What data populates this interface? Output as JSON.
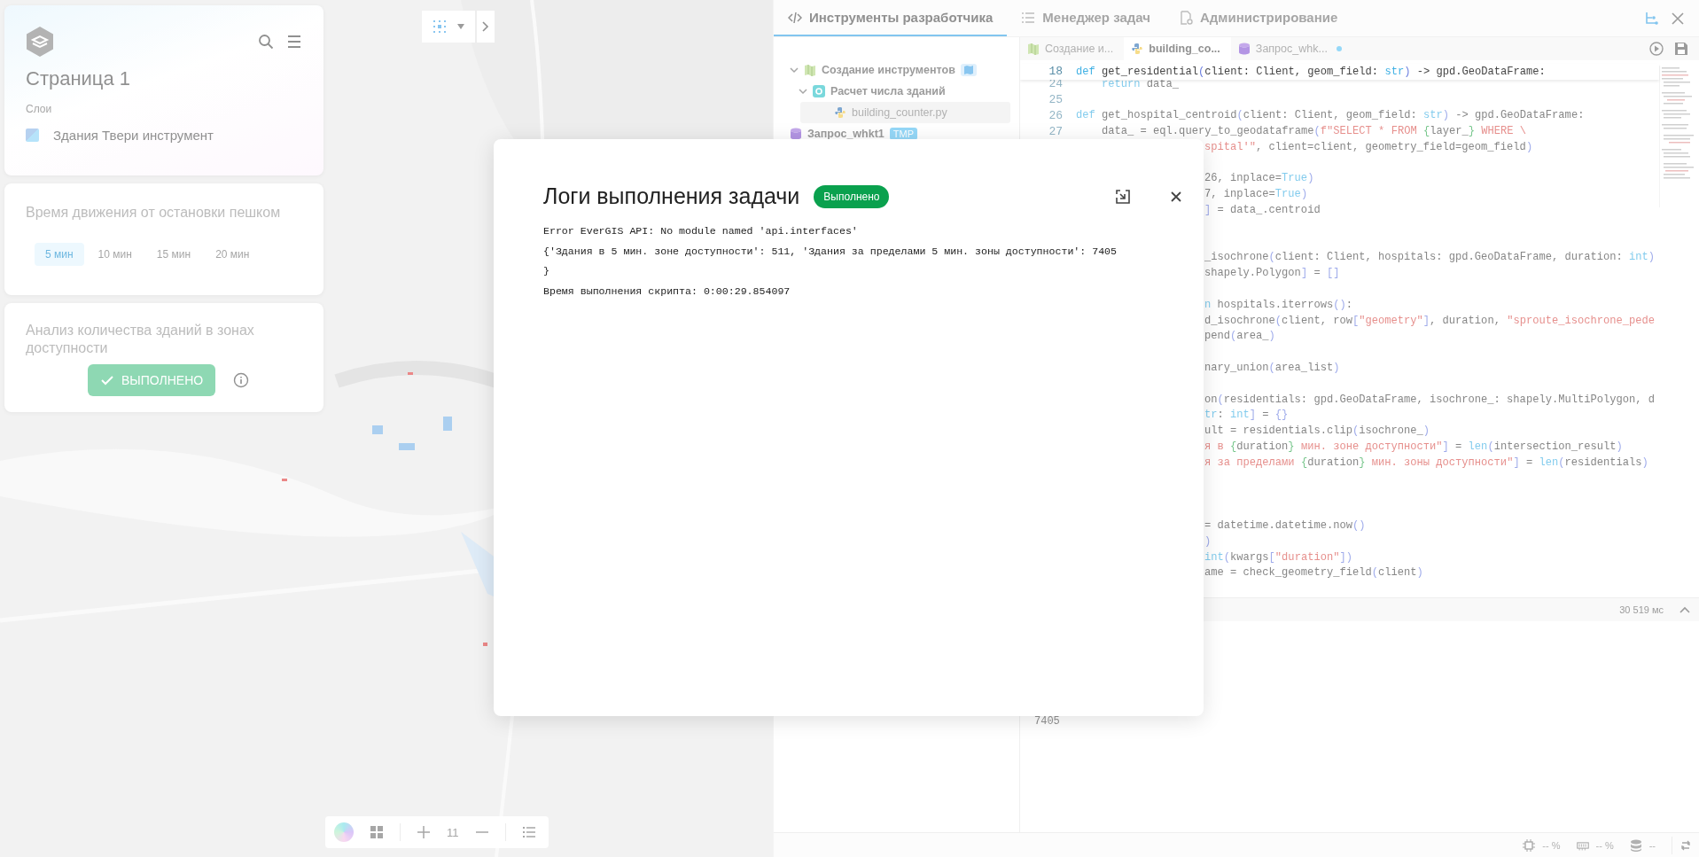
{
  "page_card": {
    "title": "Страница 1",
    "layers_label": "Слои",
    "layers": [
      {
        "name": "Здания Твери инструмент"
      }
    ]
  },
  "walk_card": {
    "title": "Время движения от остановки пешком",
    "options": [
      {
        "label": "5 мин",
        "selected": true
      },
      {
        "label": "10 мин",
        "selected": false
      },
      {
        "label": "15 мин",
        "selected": false
      },
      {
        "label": "20 мин",
        "selected": false
      }
    ]
  },
  "analysis_card": {
    "title": "Анализ количества зданий в зонах доступности",
    "button": "ВЫПОЛНЕНО"
  },
  "map_toolbar": {
    "zoom": "11"
  },
  "devtools": {
    "tabs": [
      {
        "label": "Инструменты разработчика",
        "kind": "code",
        "selected": true
      },
      {
        "label": "Менеджер задач",
        "kind": "list",
        "selected": false
      },
      {
        "label": "Администрирование",
        "kind": "admin",
        "selected": false
      }
    ],
    "tree": [
      {
        "label": "Создание инструментов",
        "kind": "project",
        "expanded": true,
        "selected": false,
        "children": [
          {
            "label": "Расчет числа зданий",
            "kind": "tool",
            "expanded": true,
            "selected": false,
            "children": [
              {
                "label": "building_counter.py",
                "kind": "python",
                "selected": true
              }
            ]
          }
        ]
      },
      {
        "label": "Запрос_whkt1",
        "kind": "query",
        "badge": "TMP",
        "selected": false
      }
    ]
  },
  "editor": {
    "tabs": [
      {
        "label": "Создание и...",
        "kind": "project",
        "selected": false,
        "modified": false
      },
      {
        "label": "building_co...",
        "kind": "python",
        "selected": true,
        "modified": false
      },
      {
        "label": "Запрос_whk...",
        "kind": "query",
        "selected": false,
        "modified": true
      }
    ],
    "code": [
      {
        "kind": "code",
        "number": "18",
        "segments": [
          {
            "kind": "keyword",
            "text": "def"
          },
          {
            "text": " get_residential"
          },
          {
            "kind": "paren",
            "text": "("
          },
          {
            "text": "client: Client, geom_field: "
          },
          {
            "kind": "keyword",
            "text": "str"
          },
          {
            "kind": "paren",
            "text": ")"
          },
          {
            "text": " -> gpd.GeoDataFrame:"
          }
        ]
      },
      {
        "kind": "code",
        "number": "24",
        "segments": [
          {
            "kind": "keyword",
            "text": "    return"
          },
          {
            "text": " data_"
          }
        ]
      },
      {
        "kind": "code",
        "number": "25"
      },
      {
        "kind": "code",
        "number": "26",
        "segments": [
          {
            "kind": "keyword",
            "text": "def"
          },
          {
            "text": " get_hospital_centroid"
          },
          {
            "kind": "paren",
            "text": "("
          },
          {
            "text": "client: Client, geom_field: "
          },
          {
            "kind": "keyword",
            "text": "str"
          },
          {
            "kind": "paren",
            "text": ")"
          },
          {
            "text": " -> gpd.GeoDataFrame:"
          }
        ]
      },
      {
        "kind": "code",
        "number": "27",
        "segments": [
          {
            "text": "    data_ = eql.query_to_geodataframe"
          },
          {
            "kind": "paren",
            "text": "("
          },
          {
            "kind": "string",
            "text": "f\"SELECT * FROM "
          },
          {
            "kind": "brace",
            "text": "{"
          },
          {
            "text": "layer_"
          },
          {
            "kind": "brace",
            "text": "}"
          },
          {
            "kind": "string",
            "text": " WHERE \\"
          }
        ]
      },
      {
        "kind": "code",
        "cut": true,
        "segments": [
          {
            "kind": "string",
            "text": "spital'\""
          },
          {
            "text": ", client=client, geometry_field=geom_field"
          },
          {
            "kind": "paren",
            "text": ")"
          }
        ]
      },
      {
        "kind": "blank"
      },
      {
        "kind": "code",
        "cut": true,
        "segments": [
          {
            "text": "26, inplace="
          },
          {
            "kind": "keyword",
            "text": "True"
          },
          {
            "kind": "paren",
            "text": ")"
          }
        ]
      },
      {
        "kind": "code",
        "cut": true,
        "segments": [
          {
            "text": "7, inplace="
          },
          {
            "kind": "keyword",
            "text": "True"
          },
          {
            "kind": "paren",
            "text": ")"
          }
        ]
      },
      {
        "kind": "code",
        "cut": true,
        "segments": [
          {
            "kind": "paren",
            "text": "]"
          },
          {
            "text": " = data_.centroid"
          }
        ]
      },
      {
        "kind": "blank"
      },
      {
        "kind": "blank"
      },
      {
        "kind": "code",
        "cut": true,
        "segments": [
          {
            "text": "_isochrone"
          },
          {
            "kind": "paren",
            "text": "("
          },
          {
            "text": "client: Client, hospitals: gpd.GeoDataFrame, duration: "
          },
          {
            "kind": "keyword",
            "text": "int"
          },
          {
            "kind": "paren",
            "text": ")"
          }
        ]
      },
      {
        "kind": "code",
        "cut": true,
        "segments": [
          {
            "text": "shapely.Polygon"
          },
          {
            "kind": "paren",
            "text": "]"
          },
          {
            "text": " = "
          },
          {
            "kind": "paren",
            "text": "[]"
          }
        ]
      },
      {
        "kind": "blank"
      },
      {
        "kind": "code",
        "cut": true,
        "segments": [
          {
            "kind": "keyword",
            "text": "n"
          },
          {
            "text": " hospitals.iterrows"
          },
          {
            "kind": "paren",
            "text": "()"
          },
          {
            "text": ":"
          }
        ]
      },
      {
        "kind": "code",
        "cut": true,
        "segments": [
          {
            "text": "d_isochrone"
          },
          {
            "kind": "paren",
            "text": "("
          },
          {
            "text": "client, row"
          },
          {
            "kind": "paren",
            "text": "["
          },
          {
            "kind": "string",
            "text": "\"geometry\""
          },
          {
            "kind": "paren",
            "text": "]"
          },
          {
            "text": ", duration, "
          },
          {
            "kind": "string",
            "text": "\"sproute_isochrone_pede"
          }
        ]
      },
      {
        "kind": "code",
        "cut": true,
        "segments": [
          {
            "text": "pend"
          },
          {
            "kind": "paren",
            "text": "("
          },
          {
            "text": "area_"
          },
          {
            "kind": "paren",
            "text": ")"
          }
        ]
      },
      {
        "kind": "blank"
      },
      {
        "kind": "code",
        "cut": true,
        "segments": [
          {
            "text": "nary_union"
          },
          {
            "kind": "paren",
            "text": "("
          },
          {
            "text": "area_list"
          },
          {
            "kind": "paren",
            "text": ")"
          }
        ]
      },
      {
        "kind": "blank"
      },
      {
        "kind": "code",
        "cut": true,
        "segments": [
          {
            "text": "on"
          },
          {
            "kind": "paren",
            "text": "("
          },
          {
            "text": "residentials: gpd.GeoDataFrame, isochrone_: shapely.MultiPolygon, d"
          }
        ]
      },
      {
        "kind": "code",
        "cut": true,
        "segments": [
          {
            "kind": "keyword",
            "text": "tr"
          },
          {
            "text": ": "
          },
          {
            "kind": "keyword",
            "text": "int"
          },
          {
            "kind": "paren",
            "text": "]"
          },
          {
            "text": " = "
          },
          {
            "kind": "paren",
            "text": "{}"
          }
        ]
      },
      {
        "kind": "code",
        "cut": true,
        "segments": [
          {
            "text": "ult = residentials.clip"
          },
          {
            "kind": "paren",
            "text": "("
          },
          {
            "text": "isochrone_"
          },
          {
            "kind": "paren",
            "text": ")"
          }
        ]
      },
      {
        "kind": "code",
        "cut": true,
        "segments": [
          {
            "kind": "string",
            "text": "я в "
          },
          {
            "kind": "brace",
            "text": "{"
          },
          {
            "text": "duration"
          },
          {
            "kind": "brace",
            "text": "}"
          },
          {
            "kind": "string",
            "text": " мин. зоне доступности\""
          },
          {
            "kind": "paren",
            "text": "]"
          },
          {
            "text": " = "
          },
          {
            "kind": "keyword",
            "text": "len"
          },
          {
            "kind": "paren",
            "text": "("
          },
          {
            "text": "intersection_result"
          },
          {
            "kind": "paren",
            "text": ")"
          }
        ]
      },
      {
        "kind": "code",
        "cut": true,
        "segments": [
          {
            "kind": "string",
            "text": "я за пределами "
          },
          {
            "kind": "brace",
            "text": "{"
          },
          {
            "text": "duration"
          },
          {
            "kind": "brace",
            "text": "}"
          },
          {
            "kind": "string",
            "text": " мин. зоны доступности\""
          },
          {
            "kind": "paren",
            "text": "]"
          },
          {
            "text": " = "
          },
          {
            "kind": "keyword",
            "text": "len"
          },
          {
            "kind": "paren",
            "text": "("
          },
          {
            "text": "residentials"
          },
          {
            "kind": "paren",
            "text": ")"
          }
        ]
      },
      {
        "kind": "blank"
      },
      {
        "kind": "blank"
      },
      {
        "kind": "blank"
      },
      {
        "kind": "code",
        "cut": true,
        "segments": [
          {
            "text": "= datetime.datetime.now"
          },
          {
            "kind": "paren",
            "text": "()"
          }
        ]
      },
      {
        "kind": "code",
        "cut": true,
        "segments": [
          {
            "kind": "paren",
            "text": ")"
          }
        ]
      },
      {
        "kind": "code",
        "cut": true,
        "segments": [
          {
            "kind": "keyword",
            "text": "int"
          },
          {
            "kind": "paren",
            "text": "("
          },
          {
            "text": "kwargs"
          },
          {
            "kind": "paren",
            "text": "["
          },
          {
            "kind": "string",
            "text": "\"duration\""
          },
          {
            "kind": "paren",
            "text": "])"
          }
        ]
      },
      {
        "kind": "code",
        "cut": true,
        "segments": [
          {
            "text": "ame = check_geometry_field"
          },
          {
            "kind": "paren",
            "text": "("
          },
          {
            "text": "client"
          },
          {
            "kind": "paren",
            "text": ")"
          }
        ]
      }
    ],
    "run_time": "30 519 мс",
    "output": [
      "7405"
    ]
  },
  "status_bar": {
    "cpu": "-- %",
    "memory": "-- %",
    "db": "--"
  },
  "modal": {
    "title": "Логи выполнения задачи",
    "status": {
      "label": "Выполнено",
      "kind": "success"
    },
    "log": [
      "Error EverGIS API: No module named 'api.interfaces'",
      "{'Здания в 5 мин. зоне доступности': 511, 'Здания за пределами 5 мин. зоны доступности': 7405",
      "}",
      "Время выполнения скрипта: 0:00:29.854097"
    ]
  }
}
